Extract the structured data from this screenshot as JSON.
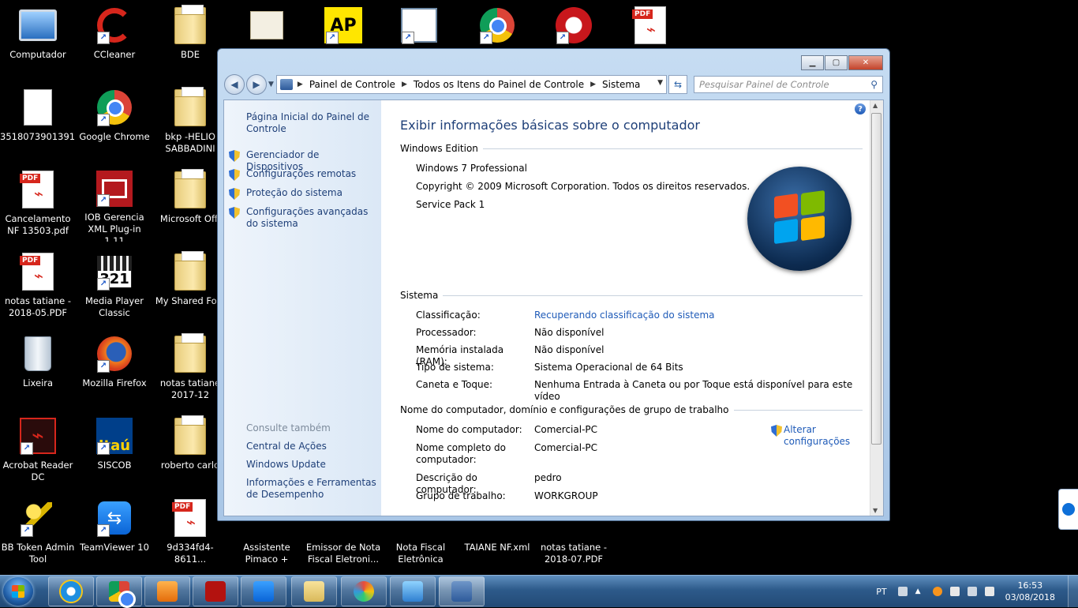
{
  "desktop": {
    "icons": [
      {
        "label": "Computador"
      },
      {
        "label": "CCleaner"
      },
      {
        "label": "BDE"
      },
      {
        "label": "3518073901391..."
      },
      {
        "label": "Google Chrome"
      },
      {
        "label": "bkp -HELIO SABBADINI"
      },
      {
        "label": "Cancelamento NF 13503.pdf"
      },
      {
        "label": "IOB Gerencia XML Plug-in 1.11"
      },
      {
        "label": "Microsoft Offi"
      },
      {
        "label": "notas tatiane - 2018-05.PDF"
      },
      {
        "label": "Media Player Classic"
      },
      {
        "label": "My Shared Fold"
      },
      {
        "label": "Lixeira"
      },
      {
        "label": "Mozilla Firefox"
      },
      {
        "label": "notas tatiane 2017-12"
      },
      {
        "label": "Acrobat Reader DC"
      },
      {
        "label": "SISCOB"
      },
      {
        "label": "roberto carlo"
      },
      {
        "label": "BB Token Admin Tool"
      },
      {
        "label": "TeamViewer 10"
      },
      {
        "label": "9d334fd4-8611..."
      },
      {
        "label": "Assistente Pimaco +"
      },
      {
        "label": "Emissor de Nota Fiscal Eletroni..."
      },
      {
        "label": "Nota Fiscal Eletrônica"
      },
      {
        "label": "TAIANE NF.xml"
      },
      {
        "label": "notas tatiane - 2018-07.PDF"
      }
    ],
    "badges": {
      "pdf": "PDF",
      "ap": "AP",
      "itau": "Itaú",
      "mpc": "321"
    }
  },
  "window": {
    "address": {
      "crumbs": [
        "Painel de Controle",
        "Todos os Itens do Painel de Controle",
        "Sistema"
      ]
    },
    "search": {
      "placeholder": "Pesquisar Painel de Controle"
    },
    "left": {
      "home": "Página Inicial do Painel de Controle",
      "tasks": [
        "Gerenciador de Dispositivos",
        "Configurações remotas",
        "Proteção do sistema",
        "Configurações avançadas do sistema"
      ],
      "see_also_title": "Consulte também",
      "see_also": [
        "Central de Ações",
        "Windows Update",
        "Informações e Ferramentas de Desempenho"
      ]
    },
    "main": {
      "title": "Exibir informações básicas sobre o computador",
      "edition_title": "Windows Edition",
      "edition_name": "Windows 7 Professional",
      "copyright": "Copyright © 2009 Microsoft Corporation. Todos os direitos reservados.",
      "service_pack": "Service Pack 1",
      "system_title": "Sistema",
      "system_rows": [
        {
          "k": "Classificação:",
          "v": "Recuperando classificação do sistema"
        },
        {
          "k": "Processador:",
          "v": "Não disponível"
        },
        {
          "k": "Memória instalada (RAM):",
          "v": "Não disponível"
        },
        {
          "k": "Tipo de sistema:",
          "v": "Sistema Operacional de 64 Bits"
        },
        {
          "k": "Caneta e Toque:",
          "v": "Nenhuma Entrada à Caneta ou por Toque está disponível para este vídeo"
        }
      ],
      "computer_title": "Nome do computador, domínio e configurações de grupo de trabalho",
      "computer_rows": [
        {
          "k": "Nome do computador:",
          "v": "Comercial-PC"
        },
        {
          "k": "Nome completo do computador:",
          "v": "Comercial-PC"
        },
        {
          "k": "Descrição do computador:",
          "v": "pedro"
        },
        {
          "k": "Grupo de trabalho:",
          "v": "WORKGROUP"
        }
      ],
      "change_settings": "Alterar configurações"
    }
  },
  "taskbar": {
    "language": "PT",
    "time": "16:53",
    "date": "03/08/2018"
  }
}
